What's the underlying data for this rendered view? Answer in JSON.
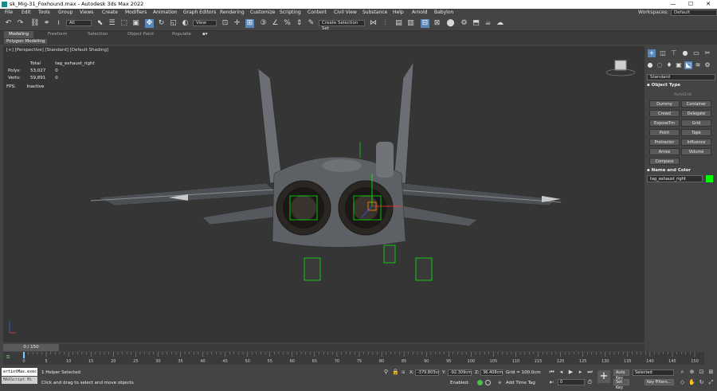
{
  "titlebar": {
    "title": "sk_Mig-31_Foxhound.max - Autodesk 3ds Max 2022",
    "minimize": "—",
    "maximize": "☐",
    "close": "✕"
  },
  "menu": {
    "items": [
      "File",
      "Edit",
      "Tools",
      "Group",
      "Views",
      "Create",
      "Modifiers",
      "Animation",
      "Graph Editors",
      "Rendering",
      "Customize",
      "Scripting",
      "Content",
      "Civil View",
      "Substance",
      "Help",
      "Arnold",
      "Babylon"
    ],
    "workspaces_label": "Workspaces:",
    "workspaces_value": "Default"
  },
  "toolbar": {
    "selection_filter": "All",
    "reference_coord": "View",
    "selection_set": "Create Selection Set"
  },
  "ribbon": {
    "tabs": [
      "Modeling",
      "Freeform",
      "Selection",
      "Object Paint",
      "Populate"
    ],
    "active_tab": "Modeling",
    "sub_label": "Polygon Modeling"
  },
  "viewport": {
    "label": "[+] [Perspective] [Standard] [Default Shading]",
    "stats": {
      "total_label": "Total",
      "object_label": "tag_exhaust_right",
      "polys_label": "Polys:",
      "polys_total": "53,027",
      "polys_obj": "0",
      "verts_label": "Verts:",
      "verts_total": "59,891",
      "verts_obj": "0"
    },
    "fps_label": "FPS:",
    "fps_value": "Inactive"
  },
  "command_panel": {
    "dropdown": "Standard",
    "object_type_title": "Object Type",
    "autogrid": "AutoGrid",
    "buttons": [
      "Dummy",
      "Container",
      "Crowd",
      "Delegate",
      "ExposeTm",
      "Grid",
      "Point",
      "Tape",
      "Protractor",
      "Influence",
      "Arrow",
      "Volume",
      "Compass"
    ],
    "name_color_title": "Name and Color",
    "object_name": "tag_exhaust_right",
    "object_color": "#00ff00"
  },
  "timeline": {
    "slider_label": "0 / 150",
    "ticks": [
      "0",
      "5",
      "10",
      "15",
      "20",
      "25",
      "30",
      "35",
      "40",
      "45",
      "50",
      "55",
      "60",
      "65",
      "70",
      "75",
      "80",
      "85",
      "90",
      "95",
      "100",
      "105",
      "110",
      "115",
      "120",
      "125",
      "130",
      "135",
      "140",
      "145",
      "150"
    ]
  },
  "status": {
    "maxscript": "ertiotMas.exec",
    "maxscript_mini": "MAXScript Mi",
    "selected": "1 Helper Selected",
    "prompt": "Click and drag to select and move objects",
    "x_label": "X:",
    "x_value": "-379.803cr",
    "y_label": "Y:",
    "y_value": "-92.309cm",
    "z_label": "Z:",
    "z_value": "36.408cm",
    "grid": "Grid = 100.0cm",
    "enabled": "Enabled:",
    "add_time_tag": "Add Time Tag",
    "auto_key": "Auto Key",
    "selected_dd": "Selected",
    "set_key": "Set Key",
    "key_filters": "Key Filters...",
    "frame": "0"
  }
}
